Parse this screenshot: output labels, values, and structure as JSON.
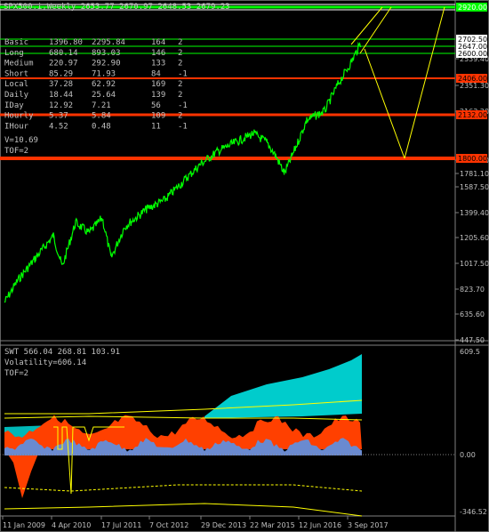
{
  "colors": {
    "background": "#000000",
    "price_line": "#00ff00",
    "green_level": "#00ff00",
    "red_level": "#ff3300",
    "yellow": "#ffff00",
    "white_level": "#ffffff",
    "swt_cyan": "#00cccc",
    "swt_red": "#ff4000",
    "swt_blue": "#6a8ad0"
  },
  "header": {
    "symbol_line": "SPX500.i,Weekly  2653.77 2670.97 2648.53 2679.23"
  },
  "main_panel": {
    "info_rows": [
      {
        "name": "Basic",
        "a": "1396.80",
        "b": "2295.84",
        "c": "164",
        "d": "2"
      },
      {
        "name": "Long",
        "a": "680.14",
        "b": "893.03",
        "c": "146",
        "d": "2"
      },
      {
        "name": "Medium",
        "a": "220.97",
        "b": "292.90",
        "c": "133",
        "d": "2"
      },
      {
        "name": "Short",
        "a": "85.29",
        "b": "71.93",
        "c": "84",
        "d": "-1"
      },
      {
        "name": "Local",
        "a": "37.28",
        "b": "62.92",
        "c": "169",
        "d": "2"
      },
      {
        "name": "Daily",
        "a": "18.44",
        "b": "25.64",
        "c": "139",
        "d": "2"
      },
      {
        "name": "IDay",
        "a": "12.92",
        "b": "7.21",
        "c": "56",
        "d": "-1"
      },
      {
        "name": "Hourly",
        "a": "5.37",
        "b": "5.84",
        "c": "109",
        "d": "2"
      },
      {
        "name": "IHour",
        "a": "4.52",
        "b": "0.48",
        "c": "11",
        "d": "-1"
      }
    ],
    "v_label": "V=10.69",
    "tof_label": "TOF=2",
    "price_axis": [
      "2539.40",
      "2351.30",
      "2163.20",
      "1969.40",
      "1781.10",
      "1587.50",
      "1399.40",
      "1205.60",
      "1017.50",
      "823.70",
      "635.60",
      "447.50"
    ],
    "level_tags": [
      {
        "label": "2920.00",
        "price": 2920
      },
      {
        "label": "2702.50",
        "price": 2702.5
      },
      {
        "label": "2647.00",
        "price": 2647
      },
      {
        "label": "2600.00",
        "price": 2600
      },
      {
        "label": "2406.00",
        "price": 2406
      },
      {
        "label": "2132.00",
        "price": 2132
      },
      {
        "label": "1800.00",
        "price": 1800
      }
    ]
  },
  "sub_panel": {
    "swt_line": "SWT 566.04 268.81 103.91",
    "volatility_line": "Volatility=606.14",
    "tof_line": "TOF=2",
    "axis": [
      "609.5",
      "0.00",
      "-346.52"
    ]
  },
  "time_axis": [
    "11 Jan 2009",
    "4 Apr 2010",
    "17 Jul 2011",
    "7 Oct 2012",
    "29 Dec 2013",
    "22 Mar 2015",
    "12 Jun 2016",
    "3 Sep 2017"
  ]
}
